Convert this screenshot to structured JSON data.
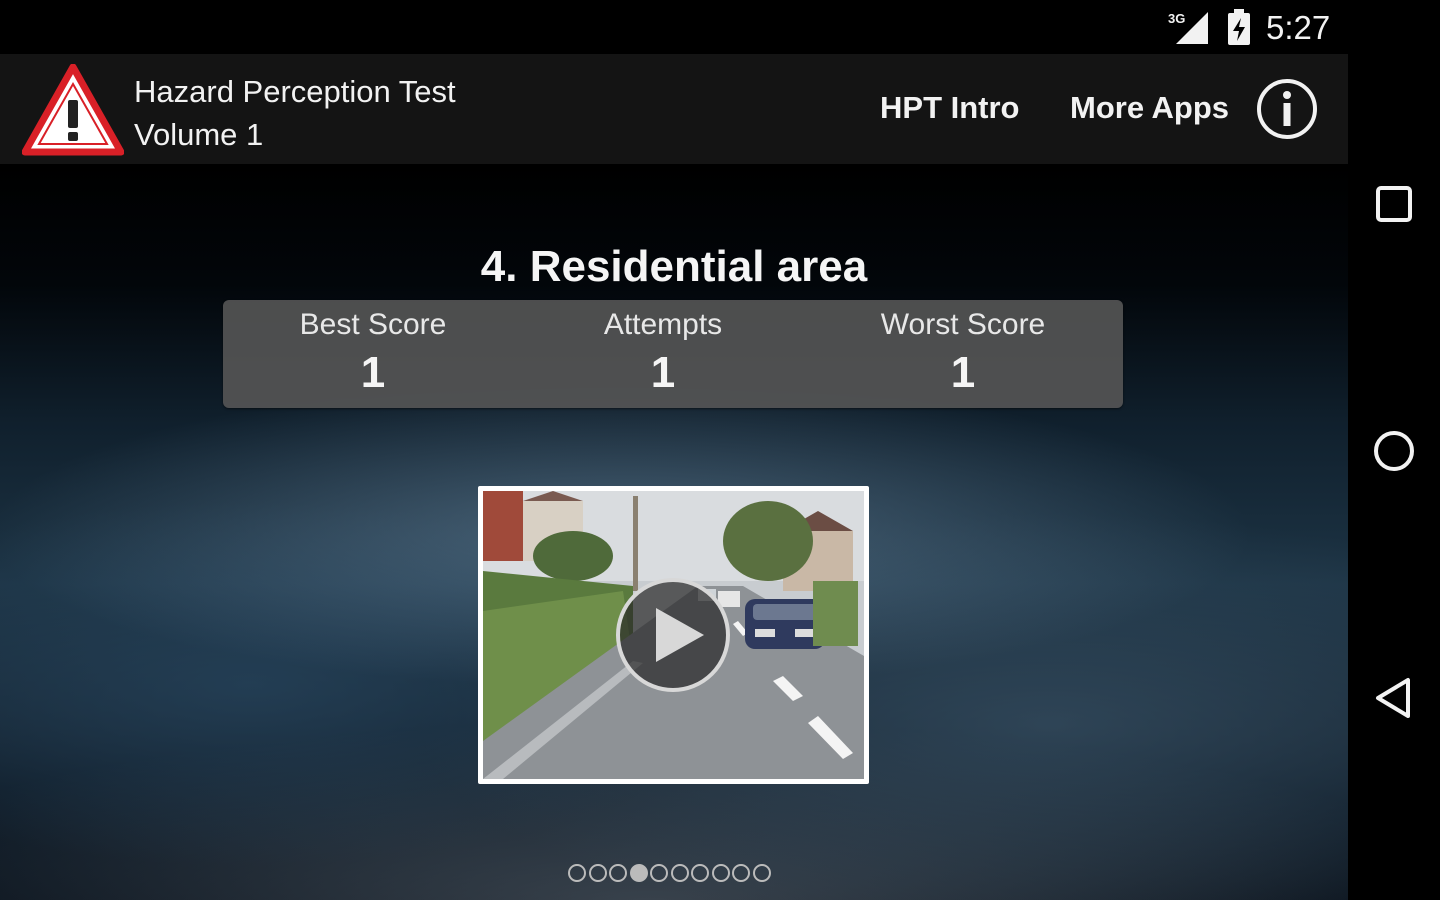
{
  "status_bar": {
    "network_label": "3G",
    "clock": "5:27",
    "icons": [
      "signal-icon",
      "battery-charging-icon"
    ]
  },
  "action_bar": {
    "title_line1": "Hazard Perception Test",
    "title_line2": "Volume 1",
    "logo": "warning-triangle-icon",
    "buttons": {
      "hpt_intro": "HPT Intro",
      "more_apps": "More Apps",
      "info": "info-icon"
    }
  },
  "test": {
    "title": "4. Residential area",
    "scores": {
      "best_label": "Best Score",
      "best_value": "1",
      "attempts_label": "Attempts",
      "attempts_value": "1",
      "worst_label": "Worst Score",
      "worst_value": "1"
    },
    "thumbnail": "residential-road-video-thumbnail",
    "play_icon": "play-icon"
  },
  "pager": {
    "total_pages": 10,
    "current_page": 4
  },
  "nav_bar": {
    "buttons": [
      "recents-icon",
      "home-icon",
      "back-icon"
    ]
  },
  "colors": {
    "warning_red": "#d92027",
    "action_bar_bg": "#141414",
    "score_panel_bg": "#555555"
  }
}
